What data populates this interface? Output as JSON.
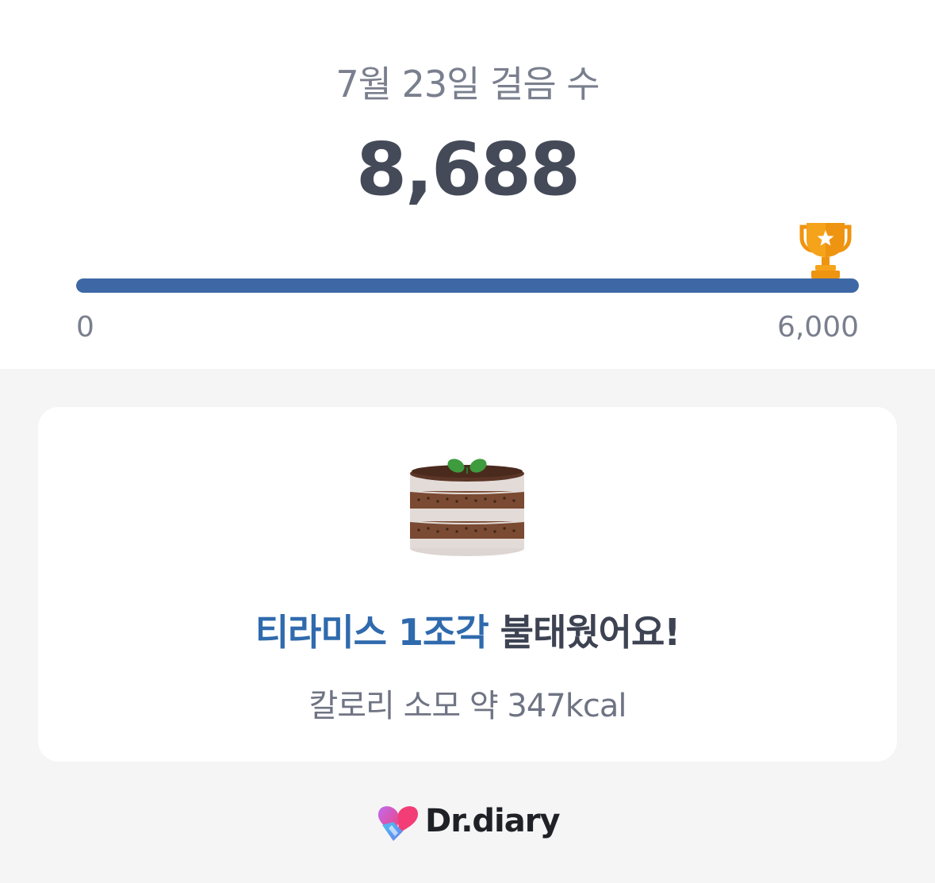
{
  "header": {
    "date_title": "7월 23일 걸음 수",
    "step_count": "8,688"
  },
  "progress": {
    "min_label": "0",
    "max_label": "6,000",
    "fill_fraction": 1.0,
    "goal_icon": "trophy-icon",
    "fill_color": "#3d68a5",
    "trophy_color": "#f5a31a"
  },
  "card": {
    "food_icon": "tiramisu-cake-icon",
    "headline_accent": "티라미스 1조각",
    "headline_rest": " 불태웠어요!",
    "calorie_text": "칼로리 소모 약 347kcal",
    "accent_color": "#2f6aad"
  },
  "footer": {
    "brand_name": "Dr.diary",
    "logo_icon": "heart-logo-icon"
  }
}
